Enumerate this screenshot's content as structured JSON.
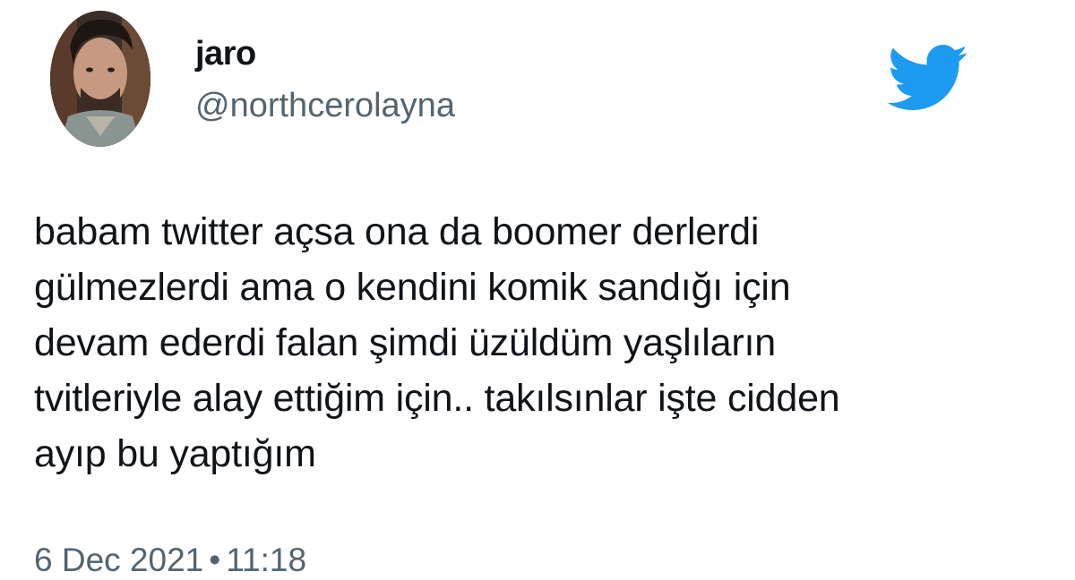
{
  "author": {
    "display_name": "jaro",
    "handle": "@northcerolayna",
    "avatar": "profile-photo"
  },
  "logo": {
    "icon": "twitter-bird-icon",
    "color": "#1d9bf0"
  },
  "tweet": {
    "text": "babam twitter açsa ona da boomer derlerdi\ngülmezlerdi ama o kendini komik sandığı için\ndevam ederdi falan şimdi üzüldüm yaşlıların\ntvitleriyle alay ettiğim için.. takılsınlar işte cidden\nayıp bu yaptığım",
    "date": "6 Dec 2021",
    "separator": "•",
    "time": "11:18"
  },
  "colors": {
    "text": "#0f1419",
    "secondary": "#536471",
    "brand": "#1d9bf0"
  }
}
